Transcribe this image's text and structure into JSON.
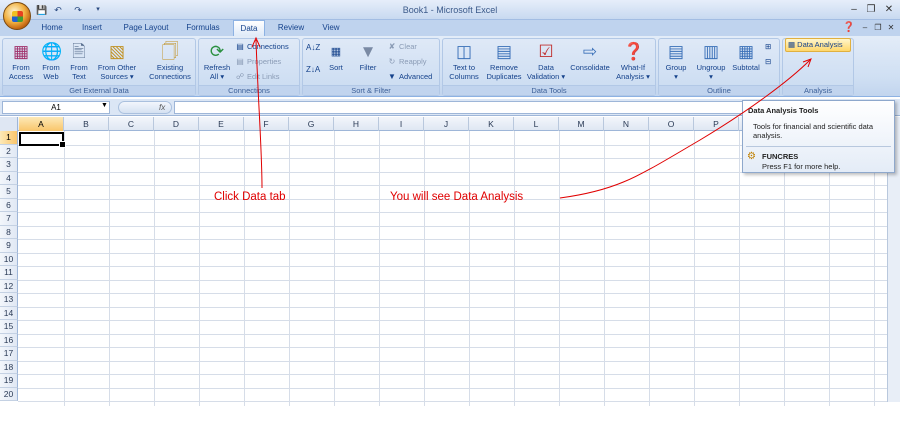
{
  "window": {
    "title": "Book1 - Microsoft Excel"
  },
  "quick_access": {
    "save_icon": "save-icon",
    "undo_icon": "undo-icon",
    "redo_icon": "redo-icon"
  },
  "tabs": [
    {
      "label": "Home",
      "active": false
    },
    {
      "label": "Insert",
      "active": false
    },
    {
      "label": "Page Layout",
      "active": false
    },
    {
      "label": "Formulas",
      "active": false
    },
    {
      "label": "Data",
      "active": true
    },
    {
      "label": "Review",
      "active": false
    },
    {
      "label": "View",
      "active": false
    }
  ],
  "ribbon": {
    "get_external_data": {
      "label": "Get External Data",
      "buttons": [
        {
          "line1": "From",
          "line2": "Access",
          "icon": "access-database-icon"
        },
        {
          "line1": "From",
          "line2": "Web",
          "icon": "web-globe-icon"
        },
        {
          "line1": "From",
          "line2": "Text",
          "icon": "text-file-icon"
        },
        {
          "line1": "From Other",
          "line2": "Sources ▾",
          "icon": "other-sources-icon"
        },
        {
          "line1": "Existing",
          "line2": "Connections",
          "icon": "existing-connections-icon"
        }
      ]
    },
    "connections": {
      "label": "Connections",
      "refresh": {
        "line1": "Refresh",
        "line2": "All ▾"
      },
      "items": [
        "Connections",
        "Properties",
        "Edit Links"
      ]
    },
    "sort_filter": {
      "label": "Sort & Filter",
      "sort": "Sort",
      "filter": "Filter",
      "clear": "Clear",
      "reapply": "Reapply",
      "advanced": "Advanced"
    },
    "data_tools": {
      "label": "Data Tools",
      "buttons": [
        {
          "line1": "Text to",
          "line2": "Columns"
        },
        {
          "line1": "Remove",
          "line2": "Duplicates"
        },
        {
          "line1": "Data",
          "line2": "Validation ▾"
        },
        {
          "line1": "Consolidate",
          "line2": ""
        },
        {
          "line1": "What-If",
          "line2": "Analysis ▾"
        }
      ]
    },
    "outline": {
      "label": "Outline",
      "buttons": [
        {
          "line1": "Group",
          "line2": "▾"
        },
        {
          "line1": "Ungroup",
          "line2": "▾"
        },
        {
          "line1": "Subtotal",
          "line2": ""
        }
      ]
    },
    "analysis": {
      "label": "Analysis",
      "data_analysis": "Data Analysis"
    }
  },
  "formula_bar": {
    "name_box": "A1",
    "fx": "fx"
  },
  "columns": [
    "A",
    "B",
    "C",
    "D",
    "E",
    "F",
    "G",
    "H",
    "I",
    "J",
    "K",
    "L",
    "M",
    "N",
    "O",
    "P"
  ],
  "rows": [
    "1",
    "2",
    "3",
    "4",
    "5",
    "6",
    "7",
    "8",
    "9",
    "10",
    "11",
    "12",
    "13",
    "14",
    "15",
    "16",
    "17",
    "18",
    "19",
    "20"
  ],
  "selected_cell": "A1",
  "tooltip": {
    "title": "Data Analysis Tools",
    "description": "Tools for financial and scientific data analysis.",
    "addin": "FUNCRES",
    "help": "Press F1 for more help."
  },
  "annotations": {
    "click_data_tab": "Click Data tab",
    "see_data_analysis": "You will see Data Analysis"
  },
  "colors": {
    "annotation": "#e00000",
    "ribbon": "#cfdff3",
    "selection": "#f9c56a"
  }
}
